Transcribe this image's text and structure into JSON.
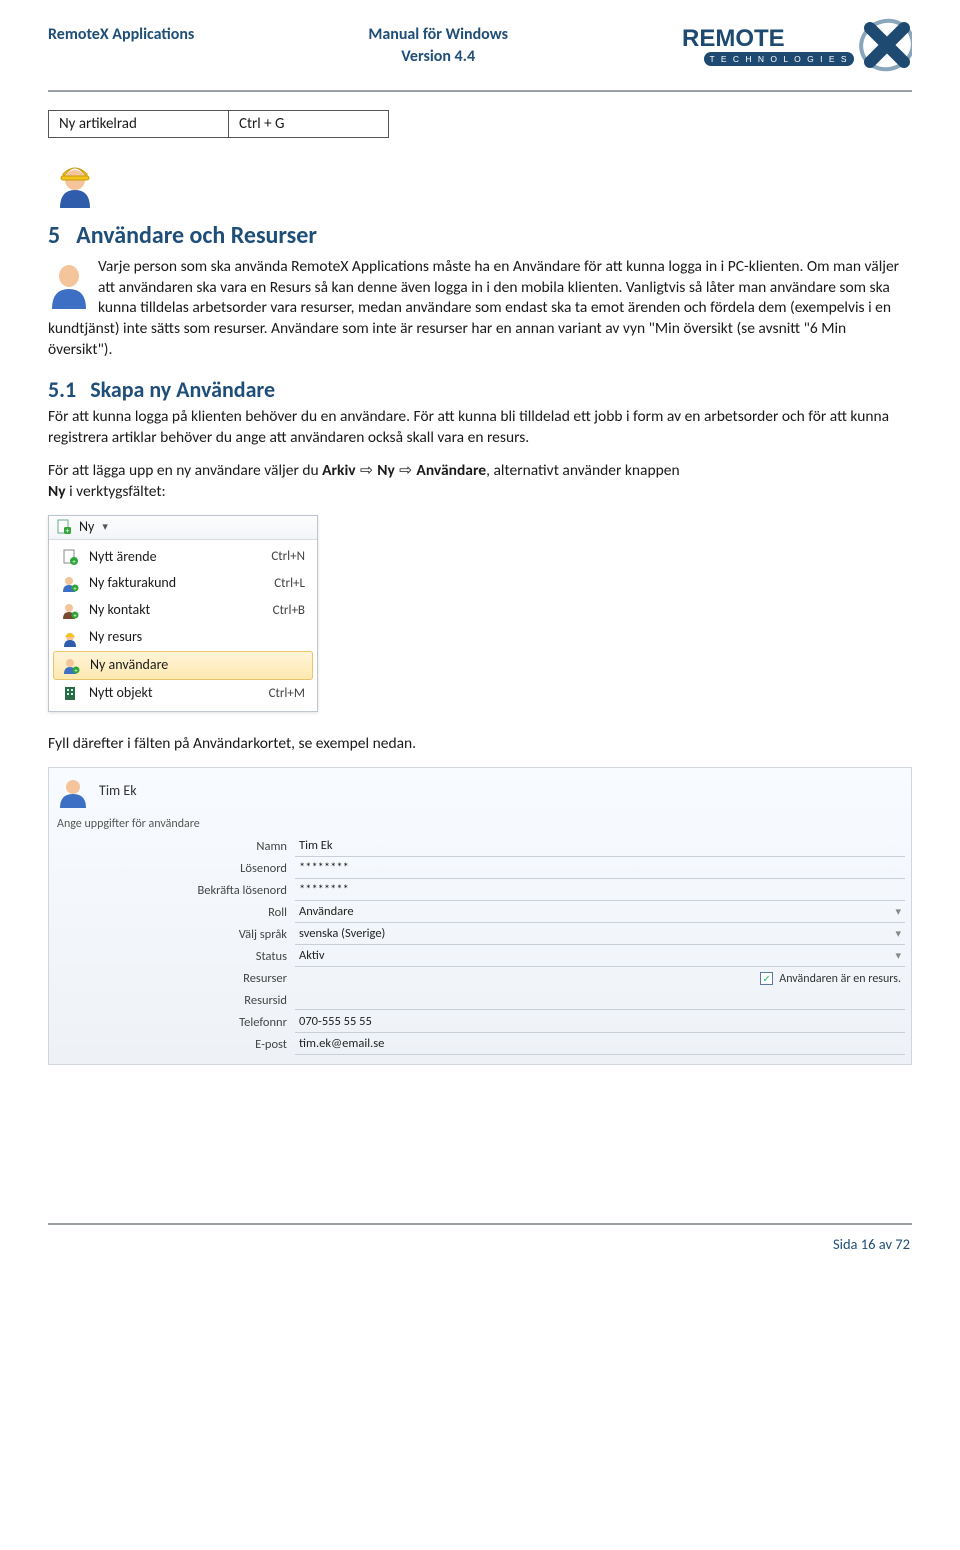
{
  "header": {
    "left": "RemoteX Applications",
    "center_line1": "Manual för Windows",
    "center_line2": "Version 4.4",
    "logo_text1": "REMOTE",
    "logo_text2": "T E C H N O L O G I E S"
  },
  "shortcut": {
    "label": "Ny artikelrad",
    "key": "Ctrl + G"
  },
  "section5": {
    "num": "5",
    "title": "Användare och Resurser",
    "para": "Varje person som ska använda RemoteX Applications måste ha en Användare för att kunna logga in i PC-klienten. Om man väljer att användaren ska vara en Resurs så kan denne även logga in i den mobila klienten. Vanligtvis så låter man användare som ska kunna tilldelas arbetsorder vara resurser, medan användare som endast ska ta emot ärenden och fördela dem (exempelvis i en kundtjänst) inte sätts som resurser. Användare som inte är resurser har en annan variant av vyn \"Min översikt (se avsnitt \"6 Min översikt\")."
  },
  "section51": {
    "num": "5.1",
    "title": "Skapa ny Användare",
    "para1": "För att kunna logga på klienten behöver du en användare. För att kunna bli tilldelad ett jobb i form av en arbetsorder och för att kunna registrera artiklar behöver du ange att användaren också skall vara en resurs.",
    "para2_pre": "För att lägga upp en ny användare väljer du ",
    "para2_b1": "Arkiv",
    "para2_arrow": " ⇨ ",
    "para2_b2": "Ny",
    "para2_b3": "Användare",
    "para2_post1": ", alternativt använder knappen",
    "para2_line2_b": "Ny",
    "para2_line2_post": " i verktygsfältet:"
  },
  "dropdown": {
    "caption": "Ny",
    "items": [
      {
        "label": "Nytt ärende",
        "shortcut": "Ctrl+N",
        "icon": "doc-plus-icon",
        "selected": false
      },
      {
        "label": "Ny fakturakund",
        "shortcut": "Ctrl+L",
        "icon": "user-plus-icon",
        "selected": false
      },
      {
        "label": "Ny kontakt",
        "shortcut": "Ctrl+B",
        "icon": "person-plus-icon",
        "selected": false
      },
      {
        "label": "Ny resurs",
        "shortcut": "",
        "icon": "worker-icon",
        "selected": false
      },
      {
        "label": "Ny användare",
        "shortcut": "",
        "icon": "user-icon",
        "selected": true
      },
      {
        "label": "Nytt objekt",
        "shortcut": "Ctrl+M",
        "icon": "building-icon",
        "selected": false
      }
    ]
  },
  "after_dropdown": "Fyll därefter i fälten på Användarkortet, se exempel nedan.",
  "userform": {
    "display_name": "Tim Ek",
    "subhint": "Ange uppgifter för användare",
    "rows": {
      "name_label": "Namn",
      "name_value": "Tim Ek",
      "password_label": "Lösenord",
      "password_value": "********",
      "confirm_label": "Bekräfta lösenord",
      "confirm_value": "********",
      "role_label": "Roll",
      "role_value": "Användare",
      "lang_label": "Välj språk",
      "lang_value": "svenska (Sverige)",
      "status_label": "Status",
      "status_value": "Aktiv",
      "resurser_label": "Resurser",
      "resurser_check_label": "Användaren är en resurs.",
      "resursid_label": "Resursid",
      "resursid_value": "",
      "phone_label": "Telefonnr",
      "phone_value": "070-555 55 55",
      "email_label": "E-post",
      "email_value": "tim.ek@email.se"
    }
  },
  "footer": {
    "page": "Sida 16 av 72"
  },
  "icons": {
    "worker_colors": {
      "helmet": "#f3c41b",
      "face": "#f5c49a",
      "shirt": "#2f5cab"
    },
    "user_colors": {
      "face": "#f4c59b",
      "shirt": "#3d6fc4",
      "plus": "#2fa43a"
    }
  }
}
